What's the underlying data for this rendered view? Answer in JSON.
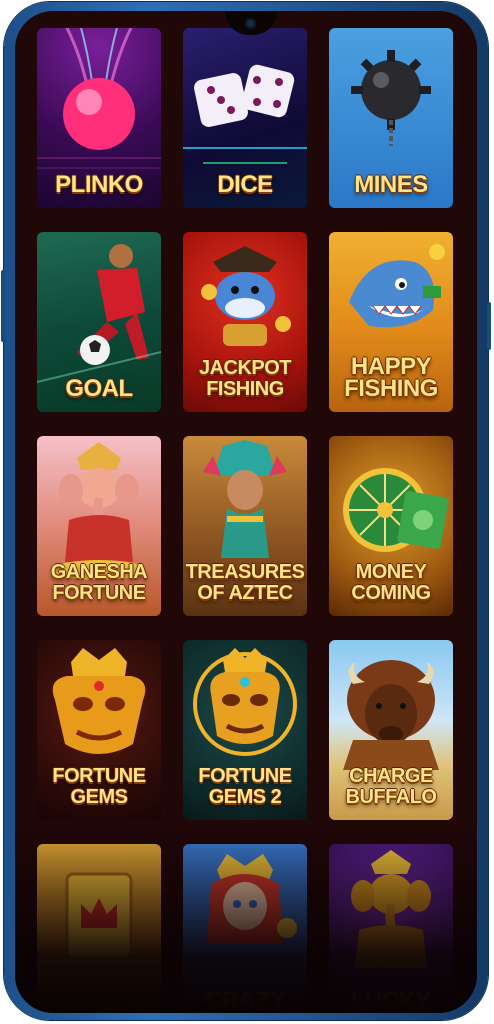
{
  "games": [
    {
      "title": "PLINKO",
      "icon": "plinko-ball-icon"
    },
    {
      "title": "DICE",
      "icon": "dice-icon"
    },
    {
      "title": "MINES",
      "icon": "mine-bomb-icon"
    },
    {
      "title": "GOAL",
      "icon": "football-player-icon"
    },
    {
      "title": "JACKPOT\nFISHING",
      "icon": "shark-pirate-icon"
    },
    {
      "title": "HAPPY\nFISHING",
      "icon": "shark-icon"
    },
    {
      "title": "GANESHA\nFORTUNE",
      "icon": "ganesha-icon"
    },
    {
      "title": "TREASURES\nOF AZTEC",
      "icon": "aztec-woman-icon"
    },
    {
      "title": "MONEY\nCOMING",
      "icon": "money-wheel-icon"
    },
    {
      "title": "FORTUNE\nGEMS",
      "icon": "golden-mask-icon"
    },
    {
      "title": "FORTUNE\nGEMS 2",
      "icon": "golden-mask-icon"
    },
    {
      "title": "CHARGE\nBUFFALO",
      "icon": "buffalo-icon"
    },
    {
      "title": "",
      "icon": "crown-card-icon"
    },
    {
      "title": "CRAZY",
      "icon": "queen-icon"
    },
    {
      "title": "LUCKY",
      "icon": "ganesha-gold-icon"
    }
  ],
  "colors": {
    "screen_bg": "#200708",
    "frame": "#2f6fb5",
    "title_gold": "#ffe48a"
  }
}
